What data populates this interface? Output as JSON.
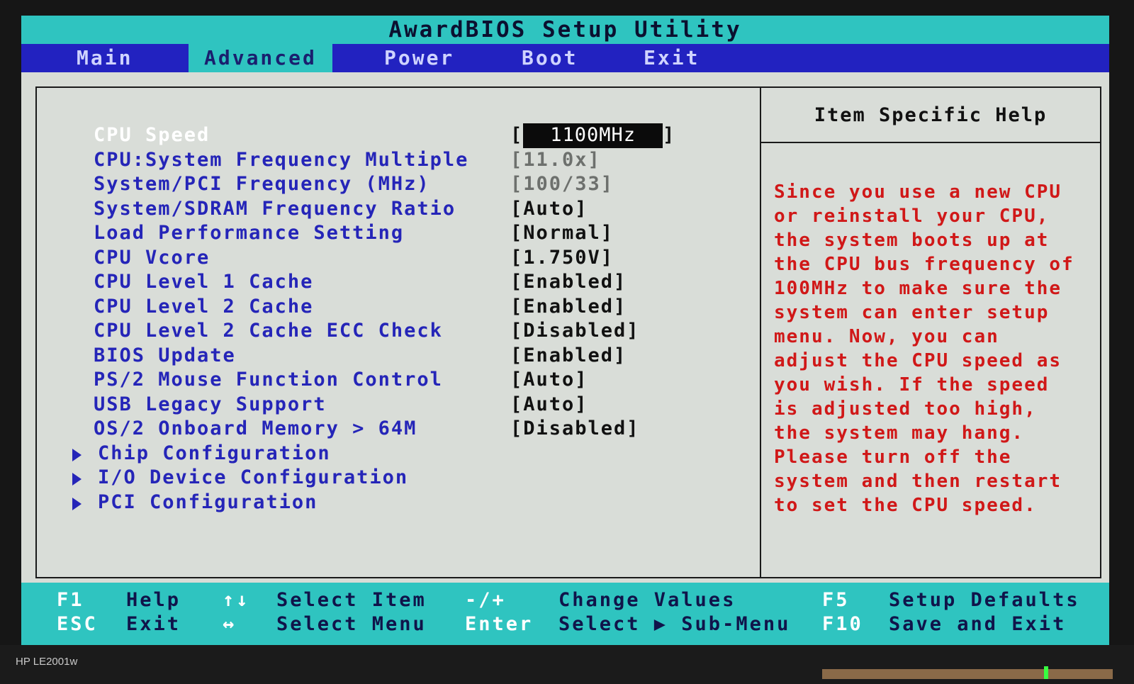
{
  "title": "AwardBIOS Setup Utility",
  "menu": {
    "tabs": [
      "Main",
      "Advanced",
      "Power",
      "Boot",
      "Exit"
    ],
    "active": "Advanced"
  },
  "settings": [
    {
      "label": "CPU Speed",
      "value": "1100MHz",
      "selected": true
    },
    {
      "label": "CPU:System Frequency Multiple",
      "value": "[11.0x]",
      "readonly": true
    },
    {
      "label": "System/PCI Frequency (MHz)",
      "value": "[100/33]",
      "readonly": true
    },
    {
      "label": "System/SDRAM Frequency Ratio",
      "value": "[Auto]"
    },
    {
      "label": "Load Performance Setting",
      "value": "[Normal]"
    },
    {
      "label": "CPU Vcore",
      "value": "[1.750V]"
    },
    {
      "label": "CPU Level 1 Cache",
      "value": "[Enabled]"
    },
    {
      "label": "CPU Level 2 Cache",
      "value": "[Enabled]"
    },
    {
      "label": "CPU Level 2 Cache ECC Check",
      "value": "[Disabled]"
    },
    {
      "label": "BIOS Update",
      "value": "[Enabled]"
    },
    {
      "label": "PS/2 Mouse Function Control",
      "value": "[Auto]"
    },
    {
      "label": "USB Legacy Support",
      "value": "[Auto]"
    },
    {
      "label": "OS/2 Onboard Memory > 64M",
      "value": "[Disabled]"
    }
  ],
  "submenus": [
    "Chip Configuration",
    "I/O Device Configuration",
    "PCI Configuration"
  ],
  "help": {
    "title": "Item Specific Help",
    "text": "Since you use a new CPU\nor reinstall your CPU,\nthe system boots up at\nthe CPU bus frequency of\n100MHz to make sure the\nsystem can enter setup\nmenu. Now, you can\nadjust the CPU speed as\nyou wish. If the speed\nis adjusted too high,\nthe system may hang.\nPlease turn off the\nsystem and then restart\nto set the CPU speed."
  },
  "footer": {
    "row1": [
      {
        "key": "F1",
        "desc": "Help"
      },
      {
        "key": "↑↓",
        "desc": "Select Item"
      },
      {
        "key": "-/+",
        "desc": "Change Values"
      },
      {
        "key": "F5",
        "desc": "Setup Defaults"
      }
    ],
    "row2": [
      {
        "key": "ESC",
        "desc": "Exit"
      },
      {
        "key": "↔",
        "desc": "Select Menu"
      },
      {
        "key": "Enter",
        "desc": "Select ▶ Sub-Menu"
      },
      {
        "key": "F10",
        "desc": "Save and Exit"
      }
    ]
  },
  "monitor": {
    "brand": "HP LE2001w"
  },
  "colors": {
    "cyan": "#2fc4c0",
    "blue": "#2222c0",
    "label_blue": "#2525b8",
    "help_red": "#d01818",
    "background": "#d9ddd8"
  }
}
